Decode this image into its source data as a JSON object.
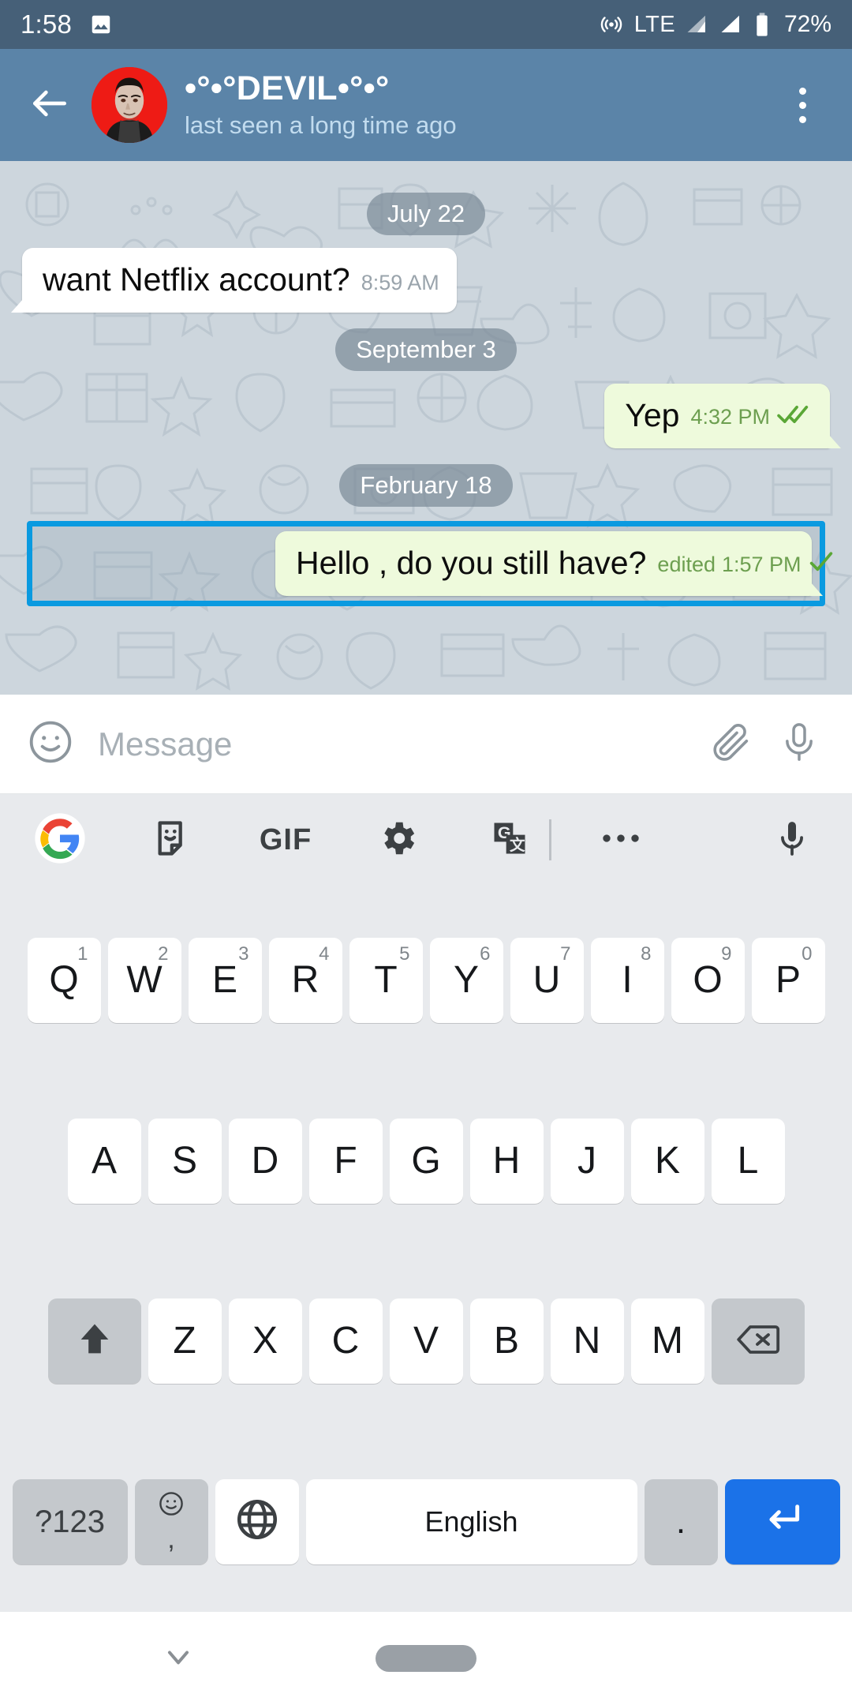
{
  "status_bar": {
    "time": "1:58",
    "left_icons": [
      "image-icon"
    ],
    "network": "LTE",
    "battery_percent": "72%",
    "right_icons": [
      "hotspot-icon",
      "signal-icon-1",
      "signal-icon-2",
      "battery-icon"
    ],
    "bg_color": "#466078"
  },
  "chat_header": {
    "title": "•°•°DEVIL•°•°",
    "subtitle": "last seen a long time ago",
    "back_icon": "back-arrow-icon",
    "menu_icon": "overflow-menu-icon",
    "avatar_alt": "contact-avatar",
    "bg_color": "#5b84a8",
    "subtitle_color": "#c2dcef"
  },
  "conversation": {
    "groups": [
      {
        "date": "July 22",
        "messages": [
          {
            "direction": "incoming",
            "text": "want Netflix account?",
            "time": "8:59 AM",
            "edited": "",
            "status": "none",
            "selected": false
          }
        ]
      },
      {
        "date": "September 3",
        "messages": [
          {
            "direction": "outgoing",
            "text": "Yep",
            "time": "4:32 PM",
            "edited": "",
            "status": "read",
            "selected": false
          }
        ]
      },
      {
        "date": "February 18",
        "messages": [
          {
            "direction": "outgoing",
            "text": "Hello , do you still have?",
            "time": "1:57 PM",
            "edited": "edited",
            "status": "sent",
            "selected": true
          }
        ]
      }
    ],
    "selection_color": "#0a9ae0",
    "outgoing_bubble_color": "#eefadc",
    "incoming_bubble_color": "#ffffff"
  },
  "input_bar": {
    "placeholder": "Message",
    "emoji_icon": "smiley-icon",
    "attach_icon": "paperclip-icon",
    "voice_icon": "microphone-icon"
  },
  "keyboard": {
    "toolbar": [
      "google-logo-icon",
      "sticker-icon",
      "gif-icon",
      "settings-gear-icon",
      "translate-icon",
      "more-options-icon",
      "microphone-icon"
    ],
    "gif_label": "GIF",
    "row1": [
      {
        "key": "Q",
        "num": "1"
      },
      {
        "key": "W",
        "num": "2"
      },
      {
        "key": "E",
        "num": "3"
      },
      {
        "key": "R",
        "num": "4"
      },
      {
        "key": "T",
        "num": "5"
      },
      {
        "key": "Y",
        "num": "6"
      },
      {
        "key": "U",
        "num": "7"
      },
      {
        "key": "I",
        "num": "8"
      },
      {
        "key": "O",
        "num": "9"
      },
      {
        "key": "P",
        "num": "0"
      }
    ],
    "row2": [
      "A",
      "S",
      "D",
      "F",
      "G",
      "H",
      "J",
      "K",
      "L"
    ],
    "row3": [
      "Z",
      "X",
      "C",
      "V",
      "B",
      "N",
      "M"
    ],
    "shift_icon": "shift-up-arrow-icon",
    "backspace_icon": "backspace-icon",
    "numeric_label": "?123",
    "comma_label": ",",
    "emoji_key_icon": "emoji-smiley-icon",
    "globe_icon": "language-globe-icon",
    "space_label": "English",
    "period_label": ".",
    "enter_icon": "enter-return-icon",
    "enter_color": "#1b72e8"
  },
  "nav_bar": {
    "hide_keyboard_icon": "chevron-down-icon",
    "home_pill": "gesture-home-pill"
  }
}
